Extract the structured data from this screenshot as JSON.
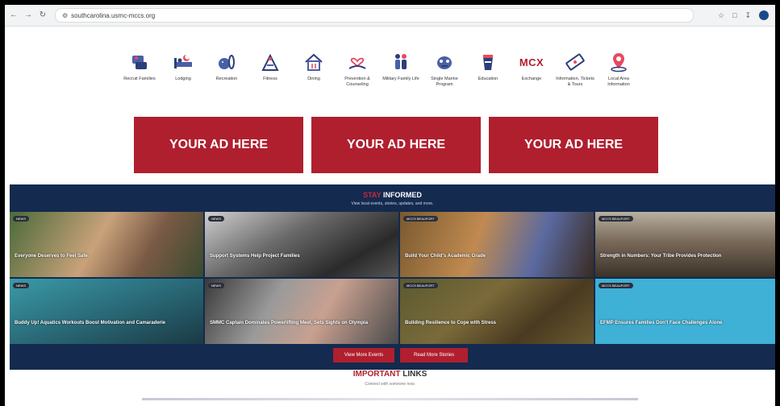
{
  "browser": {
    "url": "southcarolina.usmc-mccs.org"
  },
  "icons": [
    {
      "name": "recruit-families-icon",
      "label": "Recruit Families"
    },
    {
      "name": "lodging-icon",
      "label": "Lodging"
    },
    {
      "name": "recreation-icon",
      "label": "Recreation"
    },
    {
      "name": "fitness-icon",
      "label": "Fitness"
    },
    {
      "name": "dining-icon",
      "label": "Dining"
    },
    {
      "name": "prevention-counseling-icon",
      "label": "Prevention & Counseling"
    },
    {
      "name": "military-family-life-icon",
      "label": "Military Family Life"
    },
    {
      "name": "single-marine-program-icon",
      "label": "Single Marine Program"
    },
    {
      "name": "education-icon",
      "label": "Education"
    },
    {
      "name": "exchange-icon",
      "label": "Exchange",
      "logo": "MCX"
    },
    {
      "name": "tickets-tours-icon",
      "label": "Information, Tickets & Tours"
    },
    {
      "name": "local-area-information-icon",
      "label": "Local Area Information"
    }
  ],
  "ads": [
    "YOUR AD HERE",
    "YOUR AD HERE",
    "YOUR AD HERE"
  ],
  "informed": {
    "title_red": "STAY",
    "title": "INFORMED",
    "subtitle": "View local events, stories, updates, and more."
  },
  "tiles": [
    {
      "badge": "NEWS",
      "caption": "Everyone Deserves to Feel Safe"
    },
    {
      "badge": "NEWS",
      "caption": "Support Systems Help Project Families"
    },
    {
      "badge": "MCCS BEAUFORT",
      "caption": "Build Your Child's Academic Grade"
    },
    {
      "badge": "MCCS BEAUFORT",
      "caption": "Strength in Numbers: Your Tribe Provides Protection"
    },
    {
      "badge": "NEWS",
      "caption": "Buddy Up! Aquatics Workouts Boost Motivation and Camaraderie"
    },
    {
      "badge": "NEWS",
      "caption": "SMMC Captain Dominates Powerlifting Meet, Sets Sights on Olympia"
    },
    {
      "badge": "MCCS BEAUFORT",
      "caption": "Building Resilience to Cope with Stress"
    },
    {
      "badge": "MCCS BEAUFORT",
      "caption": "EFMP Ensures Families Don't Face Challenges Alone"
    }
  ],
  "buttons": {
    "events": "View More Events",
    "stories": "Read More Stories"
  },
  "links": {
    "title_red": "IMPORTANT",
    "title": "LINKS",
    "subtitle": "Connect with someone now."
  },
  "colors": {
    "accent": "#b01f2e",
    "navy": "#142a4f"
  }
}
